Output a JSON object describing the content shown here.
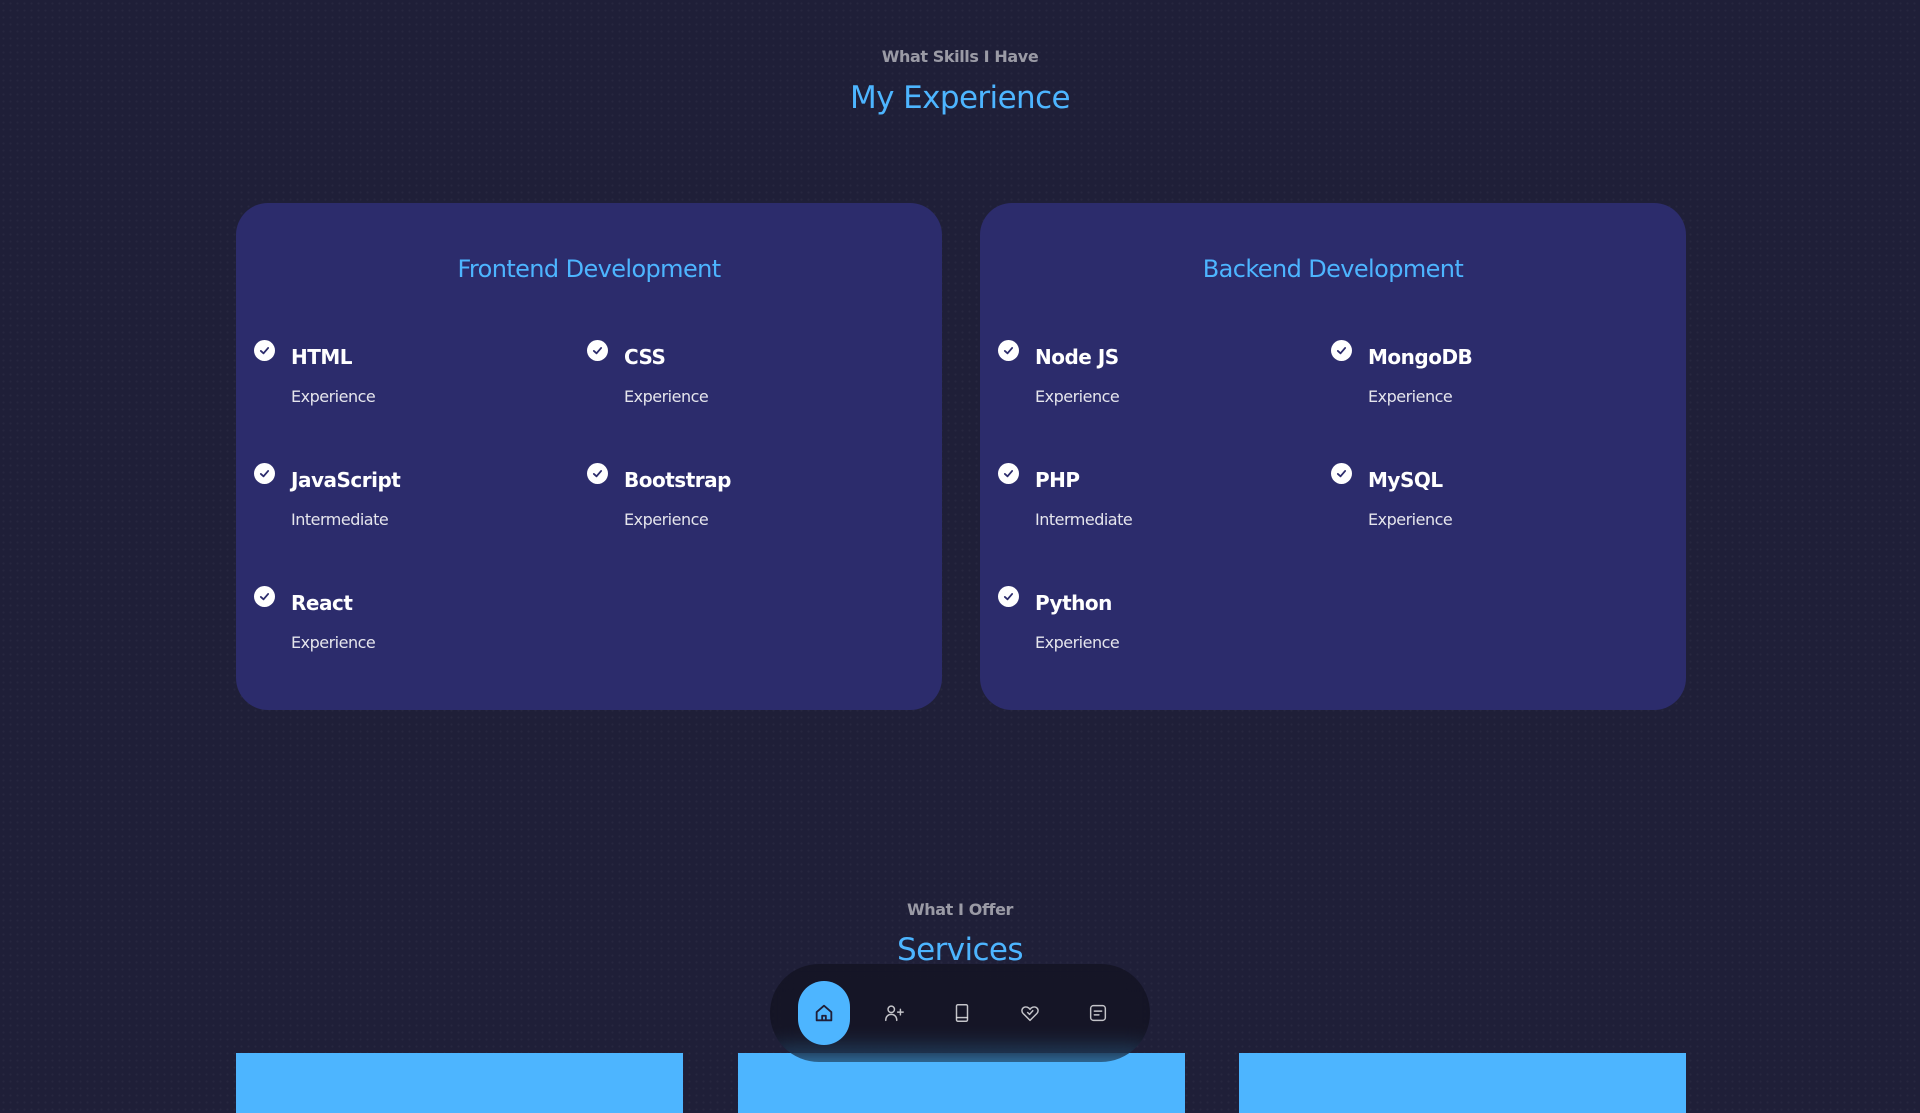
{
  "experience": {
    "eyebrow": "What Skills I Have",
    "title": "My Experience",
    "frontend": {
      "title": "Frontend Development",
      "skills": [
        {
          "name": "HTML",
          "level": "Experience"
        },
        {
          "name": "CSS",
          "level": "Experience"
        },
        {
          "name": "JavaScript",
          "level": "Intermediate"
        },
        {
          "name": "Bootstrap",
          "level": "Experience"
        },
        {
          "name": "React",
          "level": "Experience"
        }
      ]
    },
    "backend": {
      "title": "Backend Development",
      "skills": [
        {
          "name": "Node JS",
          "level": "Experience"
        },
        {
          "name": "MongoDB",
          "level": "Experience"
        },
        {
          "name": "PHP",
          "level": "Intermediate"
        },
        {
          "name": "MySQL",
          "level": "Experience"
        },
        {
          "name": "Python",
          "level": "Experience"
        }
      ]
    }
  },
  "services": {
    "eyebrow": "What I Offer",
    "title": "Services"
  },
  "nav": {
    "items": [
      {
        "icon": "home-icon",
        "active": true
      },
      {
        "icon": "user-add-icon",
        "active": false
      },
      {
        "icon": "book-icon",
        "active": false
      },
      {
        "icon": "heart-icon",
        "active": false
      },
      {
        "icon": "message-icon",
        "active": false
      }
    ]
  },
  "colors": {
    "background": "#1f1f38",
    "card": "#2c2c6c",
    "accent": "#4db5ff",
    "text": "#ffffff"
  }
}
